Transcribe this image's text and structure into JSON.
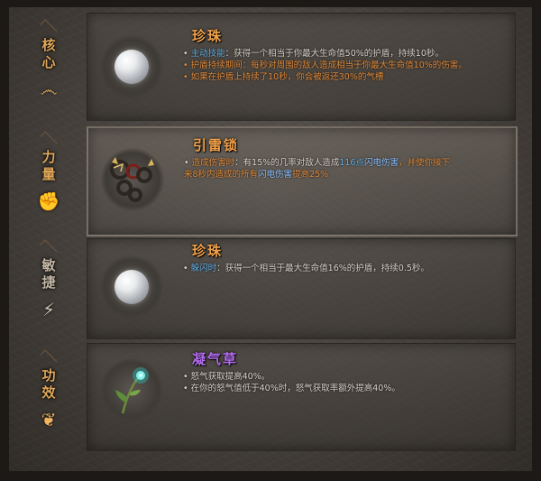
{
  "colors": {
    "title_orange": "#f2a24a",
    "title_purple": "#b46cf0",
    "skill_blue": "#61b0e6",
    "warning_orange": "#e08a3a",
    "tab_active": "#e0a85a"
  },
  "sidebar": {
    "tabs": [
      {
        "label": "核心",
        "icon": "swirl-icon",
        "glyph": "෴"
      },
      {
        "label": "力量",
        "icon": "fist-icon",
        "glyph": "✊"
      },
      {
        "label": "敏捷",
        "icon": "runner-icon",
        "glyph": "⚡"
      },
      {
        "label": "功效",
        "icon": "leaf-icon",
        "glyph": "❦"
      }
    ]
  },
  "items": [
    {
      "title": "珍珠",
      "icon": "pearl-icon",
      "lines": [
        {
          "bullet": "•",
          "prefix": "主动技能",
          "sep": "：",
          "text": "获得一个相当于你最大生命值50%的护盾，持续10秒。"
        },
        {
          "bullet": "•",
          "prefix": "护盾持续期间",
          "sep": "：",
          "text": "每秒对周围的敌人造成相当于你最大生命值10%的伤害。"
        },
        {
          "bullet": "•",
          "text": "如果在护盾上持续了10秒，你会被返还30%的气槽"
        }
      ]
    },
    {
      "title": "引雷锁",
      "icon": "lightning-chain-icon",
      "lines": [
        {
          "bullet": "•",
          "prefix": "造成伤害时",
          "sep": "：",
          "text_a": "有15%的几率对敌人造成",
          "value": "116点",
          "dmg": "闪电伤害",
          "tail": "，并使你接下"
        },
        {
          "text_b": "来8秒内造成的所有",
          "dmg": "闪电伤害",
          "tail": "提高25%"
        }
      ]
    },
    {
      "title": "珍珠",
      "icon": "pearl-icon",
      "lines": [
        {
          "bullet": "•",
          "prefix": "躲闪时",
          "sep": "：",
          "text": "获得一个相当于最大生命值16%的护盾，持续0.5秒。"
        }
      ]
    },
    {
      "title": "凝气草",
      "icon": "glowing-herb-icon",
      "lines": [
        {
          "bullet": "•",
          "text": "怒气获取提高40%。"
        },
        {
          "bullet": "•",
          "text": "在你的怒气值低于40%时，怒气获取率额外提高40%。"
        }
      ]
    }
  ]
}
